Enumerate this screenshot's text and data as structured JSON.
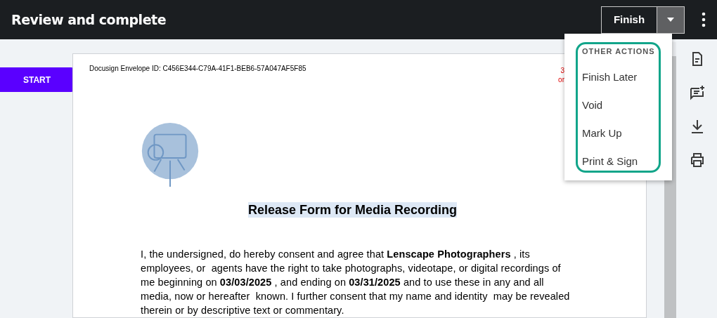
{
  "header": {
    "title": "Review and complete",
    "finish_button": "Finish",
    "dropdown_open": true
  },
  "start_button": "START",
  "document": {
    "envelope_id": "Docusign Envelope ID: C456E344-C79A-41F1-BEB6-57A047AF5F85",
    "cut_note_lines": [
      "3",
      "or"
    ],
    "heading": "Release Form for Media Recording",
    "paragraph": "I, the undersigned, do hereby consent and agree that **Lenscape Photographers** , its employees, or  agents have the right to take photographs, videotape, or digital recordings of me beginning on **03/03/2025** , and ending on **03/31/2025** and to use these in any and all media, now or hereafter  known. I further consent that my name and identity  may be revealed therein or by descriptive text or commentary."
  },
  "menu": {
    "section_title": "OTHER ACTIONS",
    "items": [
      "Finish Later",
      "Void",
      "Mark Up",
      "Print & Sign"
    ]
  },
  "side_tools": [
    {
      "kind": "document"
    },
    {
      "kind": "comment"
    },
    {
      "kind": "download"
    },
    {
      "kind": "print"
    }
  ]
}
